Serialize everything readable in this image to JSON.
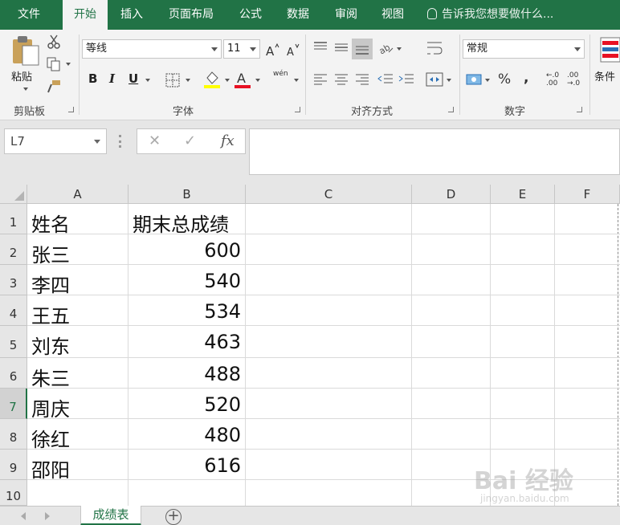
{
  "ribbon_tabs": [
    {
      "label": "文件"
    },
    {
      "label": "开始"
    },
    {
      "label": "插入"
    },
    {
      "label": "页面布局"
    },
    {
      "label": "公式"
    },
    {
      "label": "数据"
    },
    {
      "label": "审阅"
    },
    {
      "label": "视图"
    }
  ],
  "tell_me": "告诉我您想要做什么...",
  "clipboard": {
    "paste_label": "粘贴",
    "group_label": "剪贴板"
  },
  "font": {
    "name": "等线",
    "size": "11",
    "bold": "B",
    "italic": "I",
    "underline": "U",
    "phonetic": "wén",
    "group_label": "字体"
  },
  "alignment": {
    "group_label": "对齐方式"
  },
  "number": {
    "format": "常规",
    "percent": "%",
    "comma": ",",
    "inc_decimal": "←.0 .00",
    "dec_decimal": ".00 →.0",
    "group_label": "数字"
  },
  "styles": {
    "conditional_label": "条件"
  },
  "formula_bar": {
    "name_box": "L7",
    "cancel": "✕",
    "enter": "✓",
    "fx": "fx",
    "formula": ""
  },
  "columns": [
    "A",
    "B",
    "C",
    "D",
    "E",
    "F"
  ],
  "rows": [
    "1",
    "2",
    "3",
    "4",
    "5",
    "6",
    "7",
    "8",
    "9",
    "10"
  ],
  "selected_row": "7",
  "table": {
    "header": {
      "name": "姓名",
      "score": "期末总成绩"
    },
    "records": [
      {
        "name": "张三",
        "score": "600"
      },
      {
        "name": "李四",
        "score": "540"
      },
      {
        "name": "王五",
        "score": "534"
      },
      {
        "name": "刘东",
        "score": "463"
      },
      {
        "name": "朱三",
        "score": "488"
      },
      {
        "name": "周庆",
        "score": "520"
      },
      {
        "name": "徐红",
        "score": "480"
      },
      {
        "name": "邵阳",
        "score": "616"
      }
    ]
  },
  "sheet_tabs": [
    {
      "label": "成绩表"
    }
  ],
  "add_sheet": "+",
  "watermark": {
    "brand": "Bai 经验",
    "url": "jingyan.baidu.com"
  },
  "colors": {
    "accent": "#217346",
    "ribbon_bg": "#f3f3f3",
    "grid_line": "#dadada"
  }
}
